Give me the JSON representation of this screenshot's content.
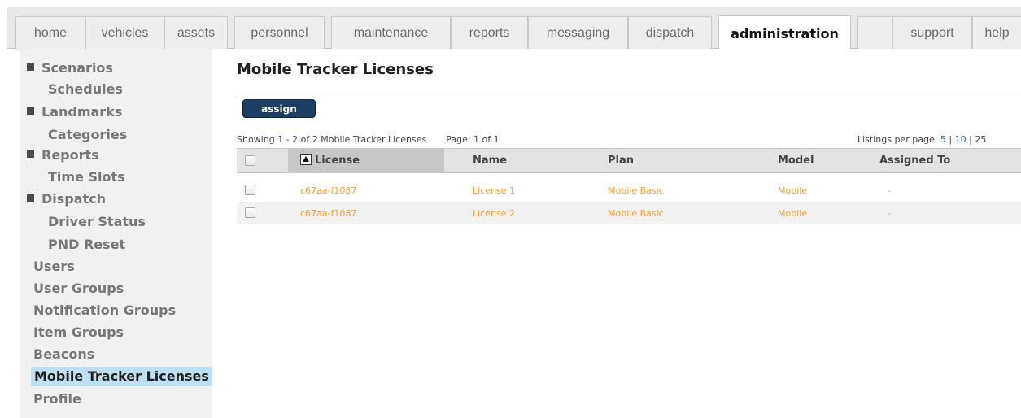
{
  "nav": {
    "tabs": [
      {
        "label": "home"
      },
      {
        "label": "vehicles"
      },
      {
        "label": "assets"
      },
      {
        "label": "personnel"
      },
      {
        "label": "maintenance"
      },
      {
        "label": "reports"
      },
      {
        "label": "messaging"
      },
      {
        "label": "dispatch"
      },
      {
        "label": "administration",
        "active": true
      },
      {
        "label": ""
      },
      {
        "label": "support"
      },
      {
        "label": "help"
      }
    ]
  },
  "sidebar": {
    "items": [
      {
        "label": "Scenarios",
        "level": "top"
      },
      {
        "label": "Schedules",
        "level": "sub"
      },
      {
        "label": "Landmarks",
        "level": "top"
      },
      {
        "label": "Categories",
        "level": "sub"
      },
      {
        "label": "Reports",
        "level": "top"
      },
      {
        "label": "Time Slots",
        "level": "sub"
      },
      {
        "label": "Dispatch",
        "level": "top"
      },
      {
        "label": "Driver Status",
        "level": "sub"
      },
      {
        "label": "PND Reset",
        "level": "sub"
      },
      {
        "label": "Users",
        "level": "plain"
      },
      {
        "label": "User Groups",
        "level": "plain"
      },
      {
        "label": "Notification Groups",
        "level": "plain"
      },
      {
        "label": "Item Groups",
        "level": "plain"
      },
      {
        "label": "Beacons",
        "level": "plain"
      },
      {
        "label": "Mobile Tracker Licenses",
        "level": "plain",
        "selected": true
      },
      {
        "label": "Profile",
        "level": "plain"
      }
    ]
  },
  "main": {
    "title": "Mobile Tracker Licenses",
    "assign_label": "assign",
    "showing_text": "Showing 1 - 2 of 2 Mobile Tracker Licenses",
    "page_text": "Page: 1 of 1",
    "per_page": {
      "label": "Listings per page:",
      "options": [
        "5",
        "10",
        "25"
      ]
    },
    "table": {
      "headers": {
        "license": "License",
        "name": "Name",
        "plan": "Plan",
        "model": "Model",
        "assigned_to": "Assigned To"
      },
      "rows": [
        {
          "license": "c67aa-f1087",
          "name": "License 1",
          "plan": "Mobile Basic",
          "model": "Mobile",
          "assigned_to": "-"
        },
        {
          "license": "c67aa-f1087",
          "name": "License 2",
          "plan": "Mobile Basic",
          "model": "Mobile",
          "assigned_to": "-"
        }
      ]
    }
  },
  "colors": {
    "link_orange": "#f0a040",
    "button_navy": "#1d3f66",
    "selected_bg": "#bfe0f2",
    "link_blue": "#2563d6"
  },
  "icons": {
    "sidebar_group": "collapse-square-icon",
    "sort": "sort-ascending-icon",
    "row_select": "checkbox-icon"
  }
}
